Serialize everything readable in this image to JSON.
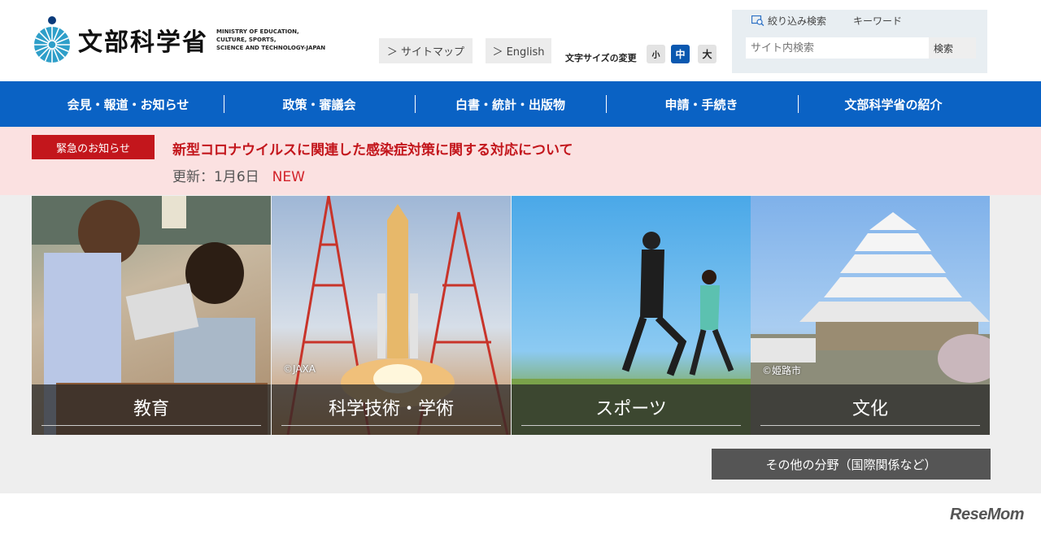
{
  "header": {
    "logo_name": "文部科学省",
    "logo_en_line1": "MINISTRY OF EDUCATION,",
    "logo_en_line2": "CULTURE, SPORTS,",
    "logo_en_line3": "SCIENCE AND TECHNOLOGY-JAPAN",
    "sitemap_label": "＞ サイトマップ",
    "english_label": "＞ English",
    "fontsize_label": "文字サイズの変更",
    "fontsize_small": "小",
    "fontsize_medium": "中",
    "fontsize_large": "大"
  },
  "search": {
    "filter_label": "絞り込み検索",
    "keyword_label": "キーワード",
    "placeholder": "サイト内検索",
    "button_label": "検索"
  },
  "nav": {
    "items": [
      {
        "label": "会見・報道・お知らせ"
      },
      {
        "label": "政策・審議会"
      },
      {
        "label": "白書・統計・出版物"
      },
      {
        "label": "申請・手続き"
      },
      {
        "label": "文部科学省の紹介"
      }
    ]
  },
  "alert": {
    "badge": "緊急のお知らせ",
    "title": "新型コロナウイルスに関連した感染症対策に関する対応について",
    "update": "更新：1月6日",
    "new_label": "NEW"
  },
  "tiles": [
    {
      "label": "教育",
      "credit": ""
    },
    {
      "label": "科学技術・学術",
      "credit": "©JAXA"
    },
    {
      "label": "スポーツ",
      "credit": ""
    },
    {
      "label": "文化",
      "credit": "©姫路市"
    }
  ],
  "other_fields_label": "その他の分野（国際関係など）",
  "watermark": "ReseMom",
  "colors": {
    "nav_blue": "#0a62c4",
    "alert_red": "#c3161c",
    "alert_bg": "#fbe1e1"
  }
}
